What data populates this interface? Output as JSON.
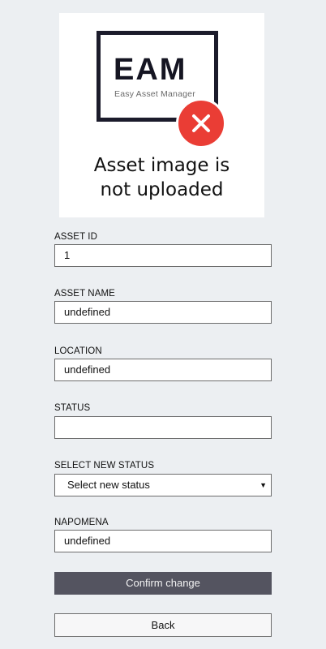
{
  "asset_image": {
    "logo_text": "EAM",
    "logo_subtitle": "Easy Asset Manager",
    "icon": "close-circle-icon",
    "caption_line1": "Asset image is",
    "caption_line2": "not uploaded",
    "badge_color": "#ea3d35"
  },
  "form": {
    "asset_id": {
      "label": "ASSET ID",
      "value": "1"
    },
    "asset_name": {
      "label": "ASSET NAME",
      "value": "undefined"
    },
    "location": {
      "label": "LOCATION",
      "value": "undefined"
    },
    "status": {
      "label": "STATUS",
      "value": ""
    },
    "new_status": {
      "label": "SELECT NEW STATUS",
      "selected": "Select new status",
      "icon": "dropdown-arrow-icon"
    },
    "napomena": {
      "label": "NAPOMENA",
      "value": "undefined"
    }
  },
  "buttons": {
    "confirm_label": "Confirm change",
    "confirm_color": "#545460",
    "back_label": "Back"
  }
}
